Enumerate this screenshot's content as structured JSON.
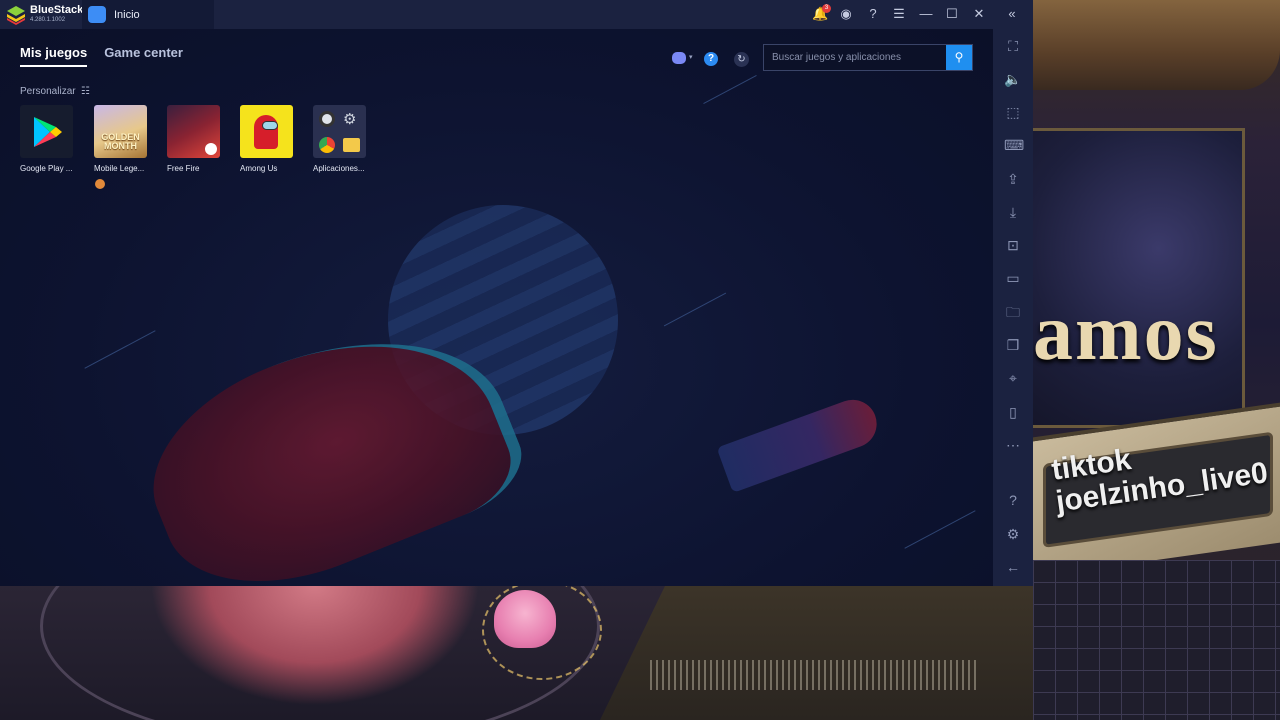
{
  "titlebar": {
    "app_name": "BlueStacks",
    "version": "4.280.1.1002",
    "home_tab": "Inicio",
    "notification_count": "3"
  },
  "nav": {
    "tabs": [
      "Mis juegos",
      "Game center"
    ],
    "active_tab": "Mis juegos"
  },
  "search": {
    "placeholder": "Buscar juegos y aplicaciones"
  },
  "library": {
    "customize_label": "Personalizar",
    "apps": [
      {
        "label": "Google Play ..."
      },
      {
        "label": "Mobile Lege..."
      },
      {
        "label": "Free Fire"
      },
      {
        "label": "Among Us"
      },
      {
        "label": "Aplicaciones..."
      }
    ],
    "mobile_legends_banner": "GOLDEN MONTH"
  },
  "overlay": {
    "banner_word": "amos",
    "tiktok_line1": "tiktok",
    "tiktok_line2": "joelzinho_live0"
  },
  "colors": {
    "accent": "#1f8ff0",
    "window_bg": "#0e1430",
    "titlebar_bg": "#1b2240"
  },
  "icons": {
    "titlebar": [
      "notifications-icon",
      "account-icon",
      "help-icon",
      "menu-icon",
      "minimize-icon",
      "maximize-icon",
      "close-icon",
      "collapse-sidebar-icon"
    ],
    "sidebar": [
      "fullscreen-icon",
      "volume-icon",
      "cursor-icon",
      "keyboard-controls-icon",
      "install-apk-icon",
      "media-import-icon",
      "screenshot-icon",
      "record-icon",
      "folder-icon",
      "multi-instance-icon",
      "location-icon",
      "shake-icon",
      "more-icon",
      "help-icon",
      "settings-icon",
      "back-icon"
    ]
  }
}
